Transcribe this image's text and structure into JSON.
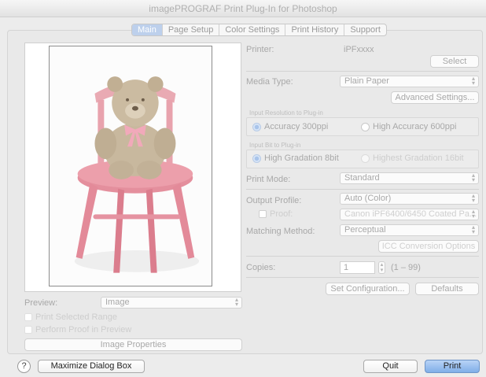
{
  "window": {
    "title": "imagePROGRAF Print Plug-In for Photoshop"
  },
  "tabs": [
    {
      "label": "Main",
      "active": true
    },
    {
      "label": "Page Setup"
    },
    {
      "label": "Color Settings"
    },
    {
      "label": "Print History"
    },
    {
      "label": "Support"
    }
  ],
  "printer": {
    "label": "Printer:",
    "value": "iPFxxxx",
    "select_label": "Select"
  },
  "media": {
    "label": "Media Type:",
    "value": "Plain Paper",
    "advanced_label": "Advanced Settings..."
  },
  "resolution": {
    "group_label": "Input Resolution to Plug-in",
    "option1": "Accuracy 300ppi",
    "option2": "High Accuracy 600ppi"
  },
  "bit": {
    "group_label": "Input Bit to Plug-in",
    "option1": "High Gradation 8bit",
    "option2": "Highest Gradation 16bit"
  },
  "print_mode": {
    "label": "Print Mode:",
    "value": "Standard"
  },
  "output_profile": {
    "label": "Output Profile:",
    "value": "Auto (Color)"
  },
  "proof": {
    "label": "Proof:",
    "value": "Canon iPF6400/6450 Coated Pa..."
  },
  "matching": {
    "label": "Matching Method:",
    "value": "Perceptual",
    "icc_label": "ICC Conversion Options"
  },
  "copies": {
    "label": "Copies:",
    "value": "1",
    "range": "(1 – 99)"
  },
  "config": {
    "set_label": "Set Configuration...",
    "defaults_label": "Defaults"
  },
  "preview": {
    "label": "Preview:",
    "value": "Image",
    "print_selected": "Print Selected Range",
    "perform_proof": "Perform Proof in Preview",
    "properties_label": "Image Properties"
  },
  "footer": {
    "help_label": "?",
    "maximize_label": "Maximize Dialog Box",
    "quit_label": "Quit",
    "print_label": "Print"
  },
  "colors": {
    "accent": "#80aee8",
    "bear": "#b8a58a",
    "chair": "#e07a8a",
    "ribbon": "#f3a6b8"
  }
}
